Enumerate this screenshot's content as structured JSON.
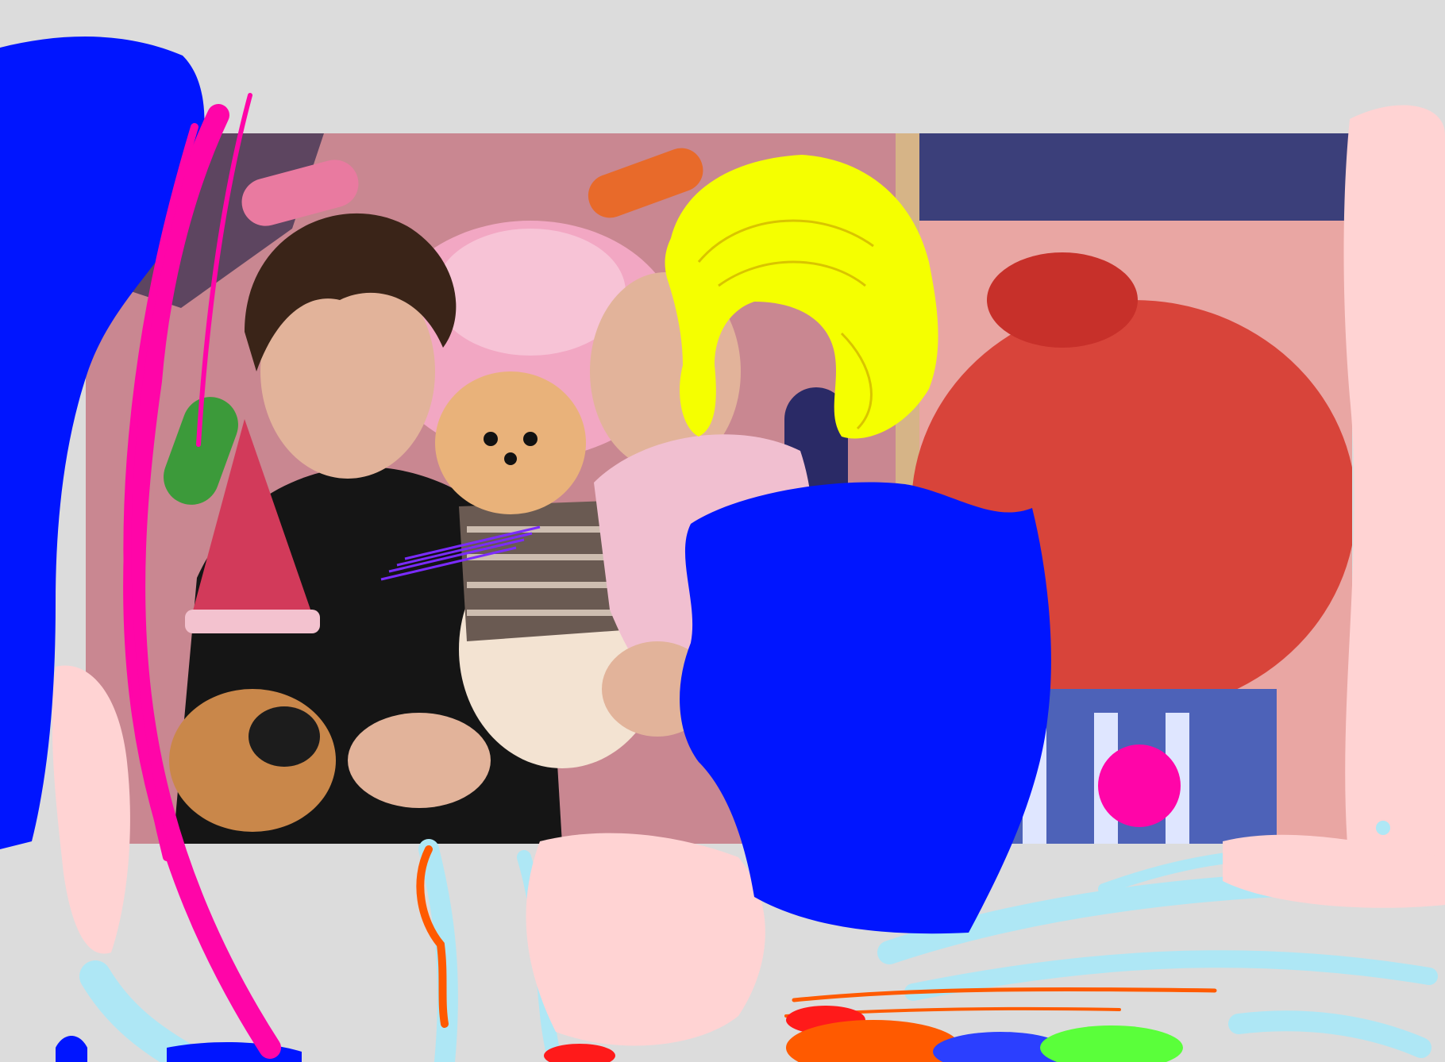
{
  "canvas": {
    "background_color": "#dcdcdc"
  },
  "photo": {
    "palette": {
      "mural_pink": "#e49aa6",
      "mural_red": "#d8443a",
      "mural_blue": "#2b3a78",
      "jellybean_green": "#3c9a3a",
      "jellybean_orange": "#e86a2a",
      "skin": "#e2b39a",
      "dark_hair": "#3a2418",
      "black_shirt": "#151515",
      "boa_pink": "#f1bfd0",
      "dog_fur": "#e9b27a",
      "party_hat": "#d23a5a"
    },
    "subjects": [
      "person-with-dark-hair",
      "pomeranian-dog-in-striped-shirt",
      "person-with-yellow-painted-hair",
      "plush-lion-with-party-hat"
    ]
  },
  "paint": {
    "blue": "#0015ff",
    "magenta": "#ff05a8",
    "yellow": "#f5ff00",
    "pale_pink": "#ffd3d3",
    "light_blue": "#aee7f5",
    "orange": "#ff5a00",
    "red": "#ff1a1a",
    "green": "#5aff3a",
    "purple": "#7b2bff"
  }
}
